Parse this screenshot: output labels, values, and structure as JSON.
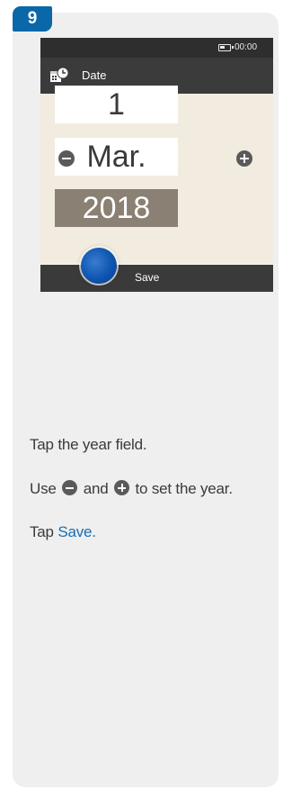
{
  "step": {
    "number": "9"
  },
  "device": {
    "status": {
      "time": "00:00"
    },
    "header": {
      "title": "Date",
      "icon": "calendar-clock-icon"
    },
    "date": {
      "day": "1",
      "month": "Mar.",
      "year": "2018"
    },
    "controls": {
      "minus_icon": "minus-circle-icon",
      "plus_icon": "plus-circle-icon"
    },
    "footer": {
      "save_label": "Save"
    }
  },
  "instructions": {
    "line1": "Tap the year field.",
    "line2_prefix": "Use",
    "line2_mid": "and",
    "line2_suffix": "to set the year.",
    "line3_prefix": "Tap",
    "line3_link": "Save."
  },
  "colors": {
    "badge": "#0a67a8",
    "link": "#1a6db5",
    "selected_field": "#8a8073",
    "bars": "#3a3a3a"
  }
}
